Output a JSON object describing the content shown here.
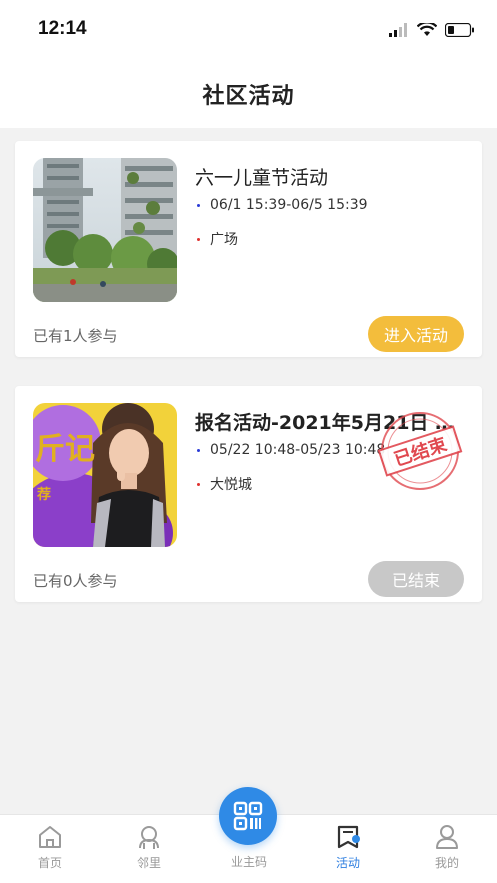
{
  "status_bar": {
    "time": "12:14"
  },
  "header": {
    "title": "社区活动"
  },
  "activities": [
    {
      "title": "六一儿童节活动",
      "time": "06/1 15:39-06/5 15:39",
      "location": "广场",
      "participants": "已有1人参与",
      "button": "进入活动",
      "status": "active"
    },
    {
      "title": "报名活动-2021年5月21日 1...",
      "time": "05/22 10:48-05/23 10:48",
      "location": "大悦城",
      "participants": "已有0人参与",
      "button": "已结束",
      "stamp": "已结束",
      "status": "ended",
      "poster_text_1": "斤记",
      "poster_text_2": "荐"
    }
  ],
  "tabbar": {
    "items": [
      {
        "label": "首页",
        "icon": "home-icon"
      },
      {
        "label": "邻里",
        "icon": "neighbor-icon"
      },
      {
        "label": "业主码",
        "icon": "qr-code-icon"
      },
      {
        "label": "活动",
        "icon": "activity-icon",
        "active": true
      },
      {
        "label": "我的",
        "icon": "person-icon"
      }
    ]
  },
  "colors": {
    "accent_blue": "#2f8ae6",
    "active_button": "#f3bd3c",
    "ended_button": "#c8c8c8",
    "stamp_red": "#e0484f"
  }
}
